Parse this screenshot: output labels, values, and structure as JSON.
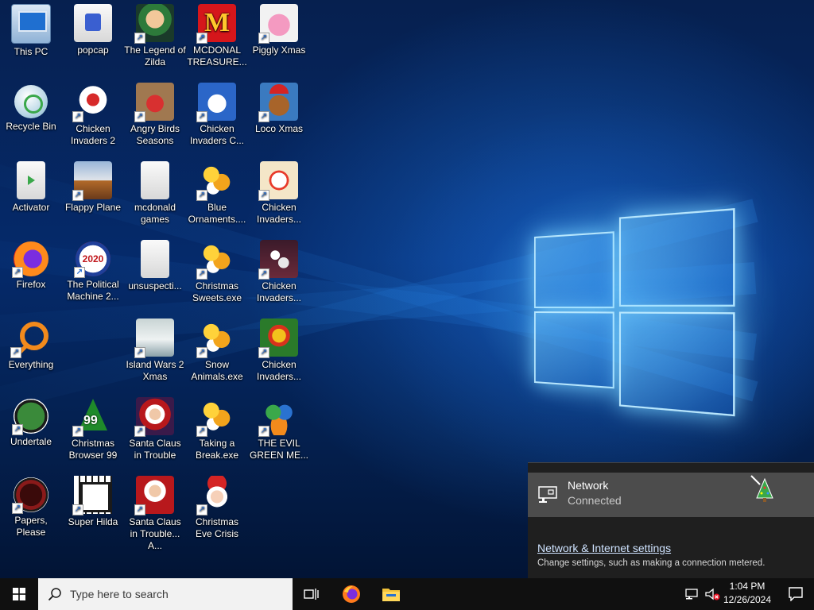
{
  "desktop": {
    "icons": [
      {
        "label": "This PC",
        "icon": "computer-icon",
        "shortcut": false
      },
      {
        "label": "popcap",
        "icon": "folder-icon",
        "shortcut": false
      },
      {
        "label": "The Legend of Zilda",
        "icon": "game-icon",
        "shortcut": true
      },
      {
        "label": "MCDONAL TREASURE...",
        "icon": "mcdonalds-icon",
        "shortcut": true
      },
      {
        "label": "Piggly Xmas",
        "icon": "pig-icon",
        "shortcut": true
      },
      {
        "label": "Recycle Bin",
        "icon": "recycle-bin-icon",
        "shortcut": false
      },
      {
        "label": "Chicken Invaders 2",
        "icon": "chicken-icon",
        "shortcut": true
      },
      {
        "label": "Angry Birds Seasons",
        "icon": "angry-birds-icon",
        "shortcut": true
      },
      {
        "label": "Chicken Invaders C...",
        "icon": "snowman-icon",
        "shortcut": true
      },
      {
        "label": "Loco Xmas",
        "icon": "bear-icon",
        "shortcut": true
      },
      {
        "label": "Activator",
        "icon": "file-icon",
        "shortcut": false
      },
      {
        "label": "Flappy Plane",
        "icon": "plane-icon",
        "shortcut": true
      },
      {
        "label": "mcdonald games",
        "icon": "folder-icon",
        "shortcut": false
      },
      {
        "label": "Blue Ornaments....",
        "icon": "puzzle-icon",
        "shortcut": true
      },
      {
        "label": "Chicken Invaders...",
        "icon": "chicken-icon",
        "shortcut": true
      },
      {
        "label": "Firefox",
        "icon": "firefox-icon",
        "shortcut": true
      },
      {
        "label": "The Political Machine 2...",
        "icon": "political-icon",
        "shortcut": true
      },
      {
        "label": "unsuspecti...",
        "icon": "folder-icon",
        "shortcut": false
      },
      {
        "label": "Christmas Sweets.exe",
        "icon": "puzzle-icon",
        "shortcut": true
      },
      {
        "label": "Chicken Invaders...",
        "icon": "chicken-icon",
        "shortcut": true
      },
      {
        "label": "Everything",
        "icon": "search-ring-icon",
        "shortcut": true
      },
      {
        "label": "Island Wars 2 Xmas",
        "icon": "island-icon",
        "shortcut": true
      },
      {
        "label": "Snow Animals.exe",
        "icon": "puzzle-icon",
        "shortcut": true
      },
      {
        "label": "Chicken Invaders...",
        "icon": "chicken-icon",
        "shortcut": true
      },
      {
        "label": "Undertale",
        "icon": "undertale-icon",
        "shortcut": true
      },
      {
        "label": "Christmas Browser 99",
        "icon": "tree-icon",
        "shortcut": true
      },
      {
        "label": "Santa Claus in Trouble",
        "icon": "santa-icon",
        "shortcut": true
      },
      {
        "label": "Taking a Break.exe",
        "icon": "puzzle-icon",
        "shortcut": true
      },
      {
        "label": "THE EVIL GREEN ME...",
        "icon": "messenger-icon",
        "shortcut": true
      },
      {
        "label": "Papers, Please",
        "icon": "papers-icon",
        "shortcut": true
      },
      {
        "label": "Super Hilda",
        "icon": "pixel-icon",
        "shortcut": true
      },
      {
        "label": "Santa Claus in Trouble... A...",
        "icon": "santa-icon",
        "shortcut": true
      },
      {
        "label": "Christmas Eve Crisis",
        "icon": "santa-icon",
        "shortcut": true
      }
    ]
  },
  "network_flyout": {
    "name": "Network",
    "status": "Connected",
    "settings_link": "Network & Internet settings",
    "settings_desc": "Change settings, such as making a connection metered."
  },
  "taskbar": {
    "search_placeholder": "Type here to search",
    "time": "1:04 PM",
    "date": "12/26/2024"
  }
}
